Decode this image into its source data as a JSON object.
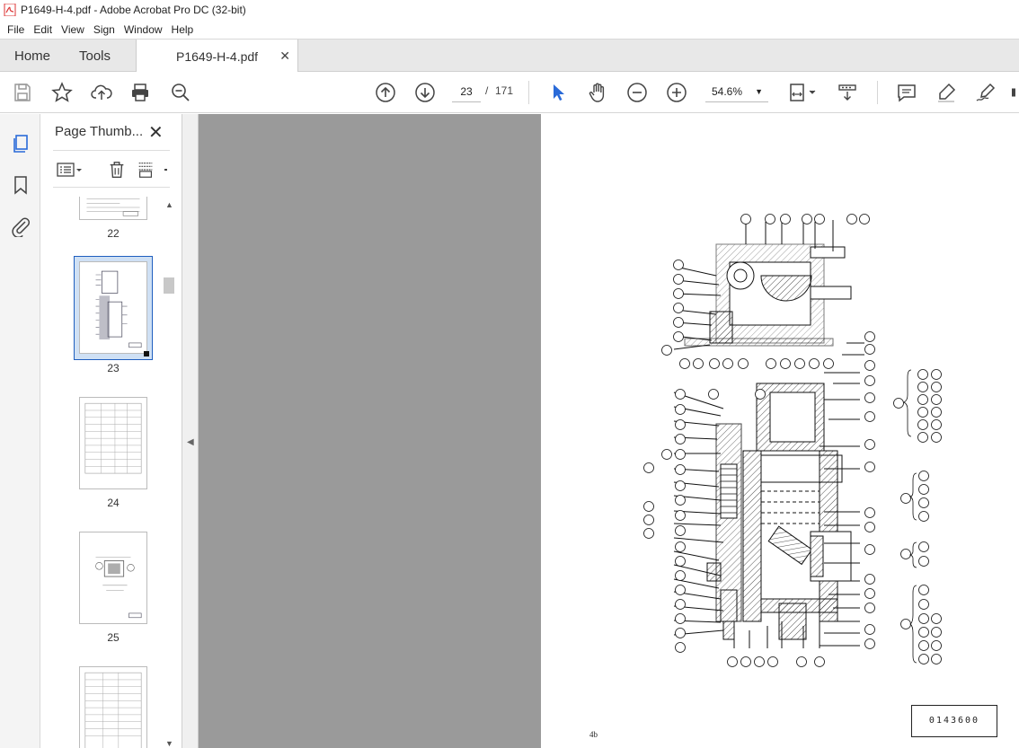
{
  "window": {
    "title": "P1649-H-4.pdf - Adobe Acrobat Pro DC (32-bit)"
  },
  "menu": [
    "File",
    "Edit",
    "View",
    "Sign",
    "Window",
    "Help"
  ],
  "tabs": {
    "home": "Home",
    "tools": "Tools",
    "document": "P1649-H-4.pdf"
  },
  "toolbar": {
    "page_current": "23",
    "page_separator": "/",
    "page_total": "171",
    "zoom": "54.6%"
  },
  "panel": {
    "title": "Page Thumb...",
    "thumbnails": [
      {
        "label": "22"
      },
      {
        "label": "23",
        "selected": true
      },
      {
        "label": "24"
      },
      {
        "label": "25"
      },
      {
        "label": ""
      }
    ]
  },
  "document": {
    "drawing_code": "0143600",
    "page_number": "4b"
  },
  "colors": {
    "accent": "#2a6ad8",
    "select_border": "#1f5fbf",
    "thumb_selected_bg": "#cfe0f4"
  }
}
